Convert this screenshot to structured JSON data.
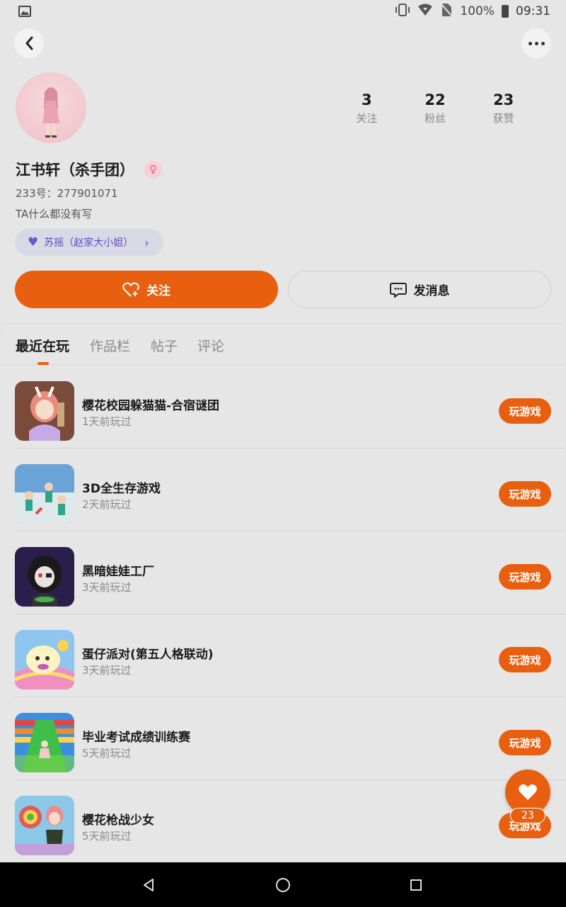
{
  "status_bar": {
    "battery_text": "100%",
    "time": "09:31"
  },
  "header": {
    "back_icon": "chevron-left-icon",
    "more_icon": "more-dots-icon"
  },
  "profile": {
    "name": "江书轩（杀手团）",
    "gender": "female",
    "gender_symbol": "♀",
    "uid": "233号：277901071",
    "bio": "TA什么都没有写",
    "relation_label": "苏摇（赵家大小姐）"
  },
  "stats": [
    {
      "value": "3",
      "label": "关注"
    },
    {
      "value": "22",
      "label": "粉丝"
    },
    {
      "value": "23",
      "label": "获赞"
    }
  ],
  "actions": {
    "follow_label": "关注",
    "message_label": "发消息"
  },
  "tabs": [
    {
      "label": "最近在玩",
      "active": true
    },
    {
      "label": "作品栏",
      "active": false
    },
    {
      "label": "帖子",
      "active": false
    },
    {
      "label": "评论",
      "active": false
    }
  ],
  "games": [
    {
      "name": "樱花校园躲猫猫-合宿谜团",
      "played": "1天前玩过",
      "button": "玩游戏"
    },
    {
      "name": "3D全生存游戏",
      "played": "2天前玩过",
      "button": "玩游戏"
    },
    {
      "name": "黑暗娃娃工厂",
      "played": "3天前玩过",
      "button": "玩游戏"
    },
    {
      "name": "蛋仔派对(第五人格联动)",
      "played": "3天前玩过",
      "button": "玩游戏"
    },
    {
      "name": "毕业考试成绩训练赛",
      "played": "5天前玩过",
      "button": "玩游戏"
    },
    {
      "name": "樱花枪战少女",
      "played": "5天前玩过",
      "button": "玩游戏"
    }
  ],
  "fab": {
    "icon": "heart-icon",
    "count": "23"
  },
  "colors": {
    "accent": "#e8600f",
    "background": "#e6e6e6",
    "relation_chip": "#d9d9e6"
  }
}
